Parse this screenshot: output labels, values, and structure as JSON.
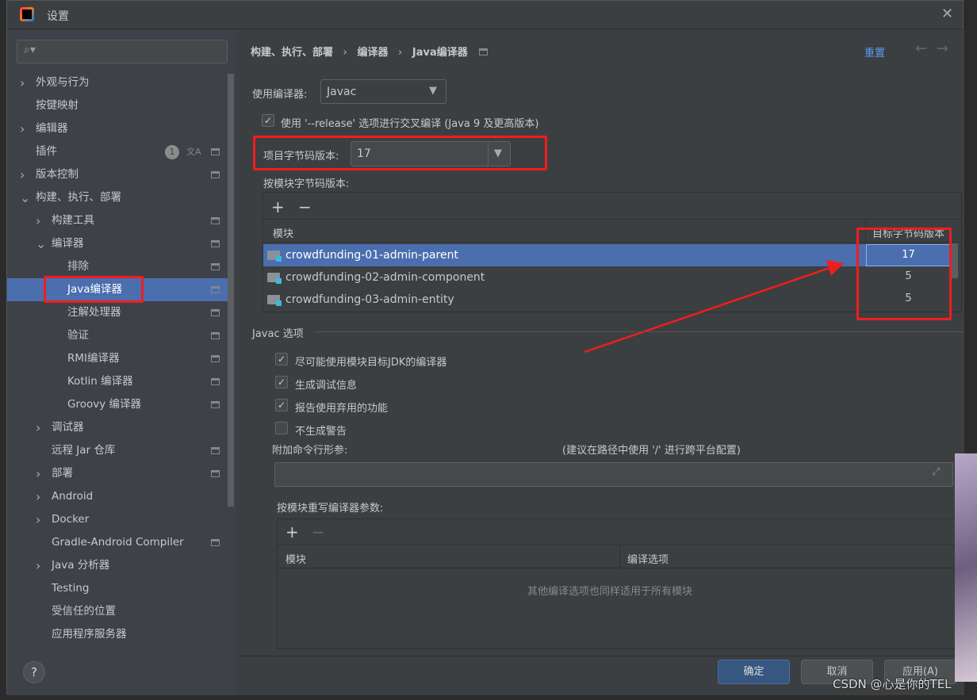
{
  "window": {
    "title": "设置",
    "logo": "intellij-idea-logo"
  },
  "search": {
    "placeholder": ""
  },
  "sidebar": {
    "items": [
      {
        "label": "外观与行为",
        "level": 0,
        "expand": "collapsed",
        "pin": false
      },
      {
        "label": "按键映射",
        "level": 0,
        "expand": "none",
        "pin": false
      },
      {
        "label": "编辑器",
        "level": 0,
        "expand": "collapsed",
        "pin": false
      },
      {
        "label": "插件",
        "level": 0,
        "expand": "none",
        "badge": "1",
        "pin": true
      },
      {
        "label": "版本控制",
        "level": 0,
        "expand": "collapsed",
        "pin": true
      },
      {
        "label": "构建、执行、部署",
        "level": 0,
        "expand": "expanded",
        "pin": false
      },
      {
        "label": "构建工具",
        "level": 1,
        "expand": "collapsed",
        "pin": true
      },
      {
        "label": "编译器",
        "level": 1,
        "expand": "expanded",
        "pin": true
      },
      {
        "label": "排除",
        "level": 2,
        "expand": "none",
        "pin": true
      },
      {
        "label": "Java编译器",
        "level": 2,
        "expand": "none",
        "pin": true,
        "selected": true
      },
      {
        "label": "注解处理器",
        "level": 2,
        "expand": "none",
        "pin": true
      },
      {
        "label": "验证",
        "level": 2,
        "expand": "none",
        "pin": true
      },
      {
        "label": "RMI编译器",
        "level": 2,
        "expand": "none",
        "pin": true
      },
      {
        "label": "Kotlin 编译器",
        "level": 2,
        "expand": "none",
        "pin": true
      },
      {
        "label": "Groovy 编译器",
        "level": 2,
        "expand": "none",
        "pin": true
      },
      {
        "label": "调试器",
        "level": 1,
        "expand": "collapsed",
        "pin": false
      },
      {
        "label": "远程 Jar 仓库",
        "level": 1,
        "expand": "none",
        "pin": true
      },
      {
        "label": "部署",
        "level": 1,
        "expand": "collapsed",
        "pin": true
      },
      {
        "label": "Android",
        "level": 1,
        "expand": "collapsed",
        "pin": false
      },
      {
        "label": "Docker",
        "level": 1,
        "expand": "collapsed",
        "pin": false
      },
      {
        "label": "Gradle-Android Compiler",
        "level": 1,
        "expand": "none",
        "pin": true
      },
      {
        "label": "Java 分析器",
        "level": 1,
        "expand": "collapsed",
        "pin": false
      },
      {
        "label": "Testing",
        "level": 1,
        "expand": "none",
        "pin": false
      },
      {
        "label": "受信任的位置",
        "level": 1,
        "expand": "none",
        "pin": false
      },
      {
        "label": "应用程序服务器",
        "level": 1,
        "expand": "none",
        "pin": false
      }
    ]
  },
  "breadcrumb": {
    "items": [
      "构建、执行、部署",
      "编译器",
      "Java编译器"
    ],
    "reset": "重置"
  },
  "compiler": {
    "label": "使用编译器:",
    "value": "Javac"
  },
  "release": {
    "label": "使用 '--release' 选项进行交叉编译 (Java 9 及更高版本)",
    "checked": true
  },
  "bytecode": {
    "label": "项目字节码版本:",
    "value": "17"
  },
  "module_bytecode": {
    "label": "按模块字节码版本:",
    "col_module": "模块",
    "col_target": "目标字节码版本",
    "rows": [
      {
        "name": "crowdfunding-01-admin-parent",
        "version": "17",
        "selected": true
      },
      {
        "name": "crowdfunding-02-admin-component",
        "version": "5"
      },
      {
        "name": "crowdfunding-03-admin-entity",
        "version": "5"
      }
    ]
  },
  "javac": {
    "section": "Javac 选项",
    "options": [
      {
        "label": "尽可能使用模块目标JDK的编译器",
        "checked": true
      },
      {
        "label": "生成调试信息",
        "checked": true
      },
      {
        "label": "报告使用弃用的功能",
        "checked": true
      },
      {
        "label": "不生成警告",
        "checked": false
      }
    ],
    "cmd_label": "附加命令行形参:",
    "cmd_hint": "(建议在路径中使用 '/' 进行跨平台配置)",
    "cmd_value": "",
    "override_label": "按模块重写编译器参数:",
    "col_module": "模块",
    "col_options": "编译选项",
    "empty": "其他编译选项也同样适用于所有模块"
  },
  "footer": {
    "ok": "确定",
    "cancel": "取消",
    "apply": "应用(A)",
    "help": "?"
  },
  "watermark": "CSDN @心是你的TEL",
  "colors": {
    "selection": "#4b6eaf",
    "annotation": "#f01d1d",
    "primary_button": "#365880"
  }
}
